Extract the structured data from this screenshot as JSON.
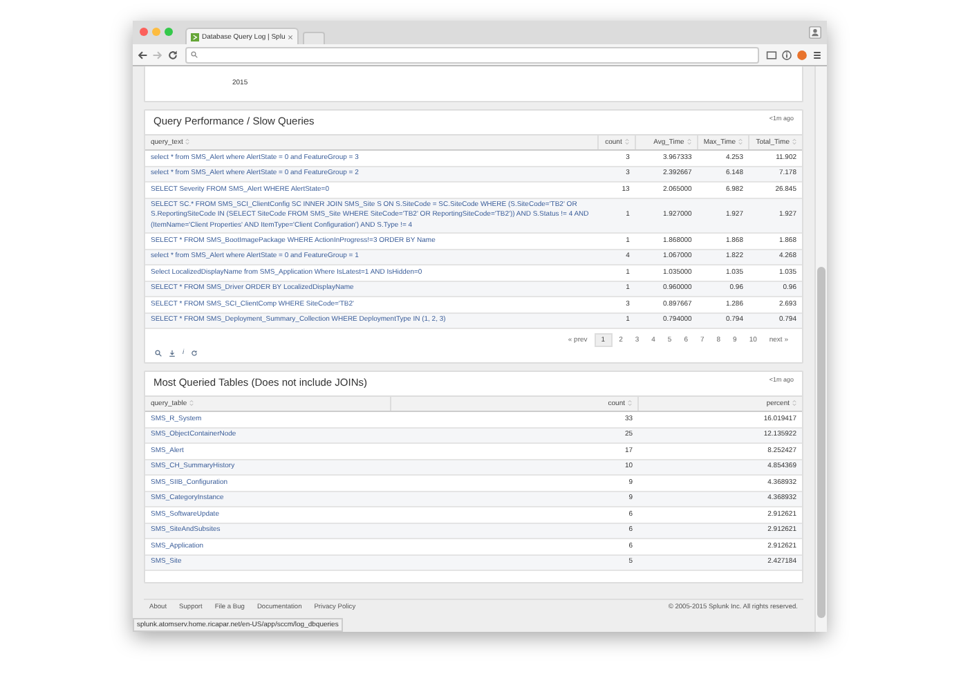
{
  "browser": {
    "tab_title": "Database Query Log | Splu",
    "status_url": "splunk.atomserv.home.ricapar.net/en-US/app/sccm/log_dbqueries"
  },
  "top_panel": {
    "axis_label": "2015"
  },
  "slow_queries": {
    "title": "Query Performance / Slow Queries",
    "updated": "<1m ago",
    "columns": [
      {
        "label": "query_text"
      },
      {
        "label": "count"
      },
      {
        "label": "Avg_Time"
      },
      {
        "label": "Max_Time"
      },
      {
        "label": "Total_Time"
      }
    ],
    "rows": [
      [
        "select * from SMS_Alert where AlertState = 0 and FeatureGroup = 3",
        "3",
        "3.967333",
        "4.253",
        "11.902"
      ],
      [
        "select * from SMS_Alert where AlertState = 0 and FeatureGroup = 2",
        "3",
        "2.392667",
        "6.148",
        "7.178"
      ],
      [
        "SELECT Severity FROM SMS_Alert WHERE AlertState=0",
        "13",
        "2.065000",
        "6.982",
        "26.845"
      ],
      [
        "SELECT SC.* FROM SMS_SCI_ClientConfig SC INNER JOIN SMS_Site S ON S.SiteCode = SC.SiteCode WHERE (S.SiteCode='TB2' OR S.ReportingSiteCode IN (SELECT SiteCode FROM SMS_Site WHERE SiteCode='TB2' OR ReportingSiteCode='TB2')) AND S.Status != 4 AND (ItemName='Client Properties' AND ItemType='Client Configuration') AND S.Type != 4",
        "1",
        "1.927000",
        "1.927",
        "1.927"
      ],
      [
        "SELECT * FROM SMS_BootImagePackage WHERE ActionInProgress!=3 ORDER BY Name",
        "1",
        "1.868000",
        "1.868",
        "1.868"
      ],
      [
        "select * from SMS_Alert where AlertState = 0 and FeatureGroup = 1",
        "4",
        "1.067000",
        "1.822",
        "4.268"
      ],
      [
        "Select LocalizedDisplayName from SMS_Application Where IsLatest=1 AND IsHidden=0",
        "1",
        "1.035000",
        "1.035",
        "1.035"
      ],
      [
        "SELECT * FROM SMS_Driver ORDER BY LocalizedDisplayName",
        "1",
        "0.960000",
        "0.96",
        "0.96"
      ],
      [
        "SELECT * FROM SMS_SCI_ClientComp WHERE SiteCode='TB2'",
        "3",
        "0.897667",
        "1.286",
        "2.693"
      ],
      [
        "SELECT * FROM SMS_Deployment_Summary_Collection WHERE DeploymentType IN (1, 2, 3)",
        "1",
        "0.794000",
        "0.794",
        "0.794"
      ]
    ],
    "pagination": {
      "prev": "« prev",
      "next": "next »",
      "pages": [
        {
          "label": "1",
          "selected": true
        },
        {
          "label": "2",
          "selected": false
        },
        {
          "label": "3",
          "selected": false
        },
        {
          "label": "4",
          "selected": false
        },
        {
          "label": "5",
          "selected": false
        },
        {
          "label": "6",
          "selected": false
        },
        {
          "label": "7",
          "selected": false
        },
        {
          "label": "8",
          "selected": false
        },
        {
          "label": "9",
          "selected": false
        },
        {
          "label": "10",
          "selected": false
        }
      ]
    },
    "info_glyph": "i"
  },
  "queried_tables": {
    "title": "Most Queried Tables (Does not include JOINs)",
    "updated": "<1m ago",
    "columns": [
      {
        "label": "query_table"
      },
      {
        "label": "count"
      },
      {
        "label": "percent"
      }
    ],
    "rows": [
      [
        "SMS_R_System",
        "33",
        "16.019417"
      ],
      [
        "SMS_ObjectContainerNode",
        "25",
        "12.135922"
      ],
      [
        "SMS_Alert",
        "17",
        "8.252427"
      ],
      [
        "SMS_CH_SummaryHistory",
        "10",
        "4.854369"
      ],
      [
        "SMS_SIIB_Configuration",
        "9",
        "4.368932"
      ],
      [
        "SMS_CategoryInstance",
        "9",
        "4.368932"
      ],
      [
        "SMS_SoftwareUpdate",
        "6",
        "2.912621"
      ],
      [
        "SMS_SiteAndSubsites",
        "6",
        "2.912621"
      ],
      [
        "SMS_Application",
        "6",
        "2.912621"
      ],
      [
        "SMS_Site",
        "5",
        "2.427184"
      ]
    ]
  },
  "footer": {
    "links": [
      "About",
      "Support",
      "File a Bug",
      "Documentation",
      "Privacy Policy"
    ],
    "copyright": "© 2005-2015 Splunk Inc. All rights reserved."
  }
}
